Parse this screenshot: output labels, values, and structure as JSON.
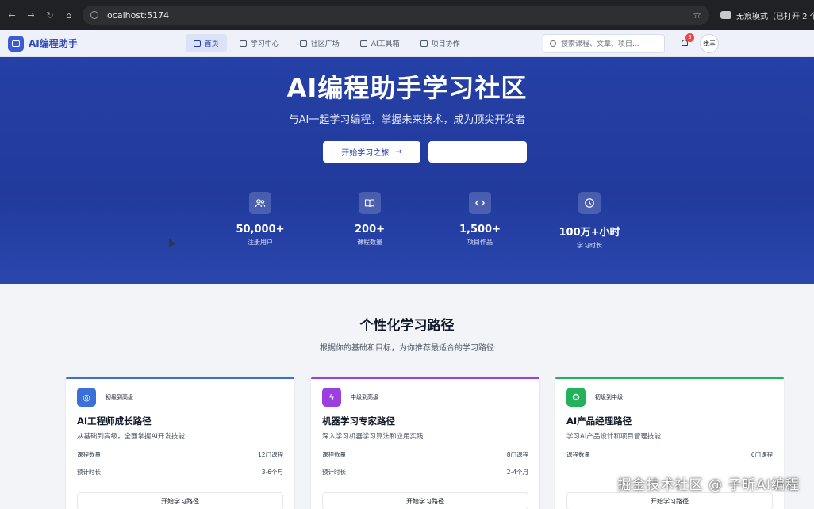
{
  "browser": {
    "url": "localhost:5174",
    "incognito_label": "无痕模式（已打开 2 个窗"
  },
  "header": {
    "logo_text": "AI编程助手",
    "tabs": [
      {
        "label": "首页",
        "active": true
      },
      {
        "label": "学习中心",
        "active": false
      },
      {
        "label": "社区广场",
        "active": false
      },
      {
        "label": "AI工具箱",
        "active": false
      },
      {
        "label": "项目协作",
        "active": false
      }
    ],
    "search_placeholder": "搜索课程、文章、项目...",
    "notification_count": "3",
    "user_name": "张三"
  },
  "hero": {
    "title": "AI编程助手学习社区",
    "subtitle": "与AI一起学习编程，掌握未来技术，成为顶尖开发者",
    "primary_button": "开始学习之旅",
    "stats": [
      {
        "value": "50,000+",
        "label": "注册用户",
        "icon": "users-icon"
      },
      {
        "value": "200+",
        "label": "课程数量",
        "icon": "book-icon"
      },
      {
        "value": "1,500+",
        "label": "项目作品",
        "icon": "code-icon"
      },
      {
        "value": "100万+小时",
        "label": "学习时长",
        "icon": "clock-icon"
      }
    ]
  },
  "paths_section": {
    "title": "个性化学习路径",
    "subtitle": "根据你的基础和目标，为你推荐最适合的学习路径",
    "cards": [
      {
        "level": "初级到高级",
        "title": "AI工程师成长路径",
        "desc": "从基础到高级，全面掌握AI开发技能",
        "course_label": "课程数量",
        "course_value": "12门课程",
        "duration_label": "预计时长",
        "duration_value": "3-6个月",
        "cta": "开始学习路径",
        "color": "#3b6fd9"
      },
      {
        "level": "中级到高级",
        "title": "机器学习专家路径",
        "desc": "深入学习机器学习算法和应用实践",
        "course_label": "课程数量",
        "course_value": "8门课程",
        "duration_label": "预计时长",
        "duration_value": "2-4个月",
        "cta": "开始学习路径",
        "color": "#9b3fe0"
      },
      {
        "level": "初级到中级",
        "title": "AI产品经理路径",
        "desc": "学习AI产品设计和项目管理技能",
        "course_label": "课程数量",
        "course_value": "6门课程",
        "duration_label": "",
        "duration_value": "",
        "cta": "开始学习路径",
        "color": "#22b35a"
      }
    ]
  },
  "watermark": "掘金技术社区 @ 子昕AI编程"
}
